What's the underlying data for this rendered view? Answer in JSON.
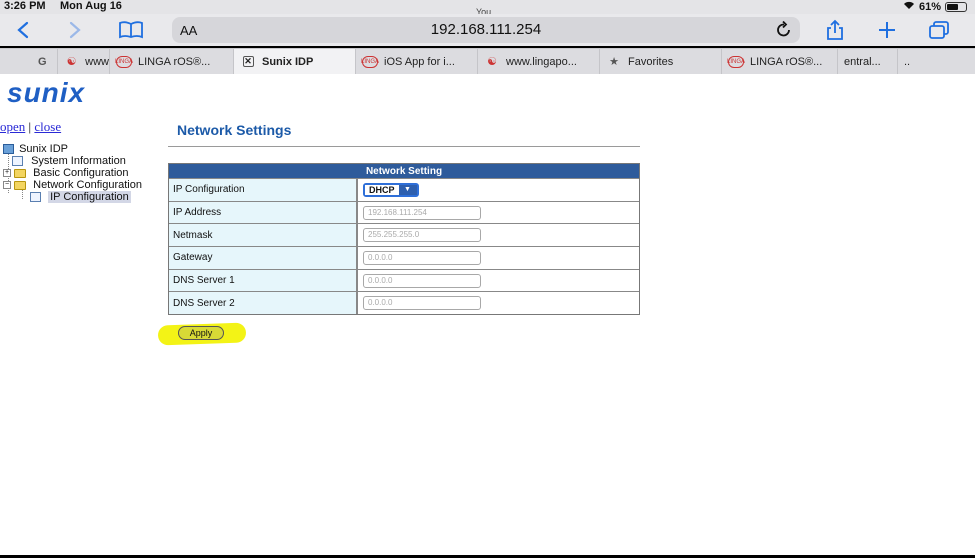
{
  "status_bar": {
    "time": "3:26 PM",
    "date": "Mon Aug 16",
    "you": "You",
    "battery": "61%",
    "battery_level": 0.61
  },
  "toolbar": {
    "text_size": "AA",
    "url": "192.168.111.254",
    "icons": [
      "back-icon",
      "forward-icon",
      "bookmarks-icon",
      "reload-icon",
      "share-icon",
      "new-tab-icon",
      "tabs-icon"
    ]
  },
  "tabs": [
    {
      "label": "www",
      "favicon": "google"
    },
    {
      "label": "LINGA rOS®...",
      "favicon": "linga"
    },
    {
      "label": "Sunix IDP",
      "favicon": "close",
      "active": true
    },
    {
      "label": "iOS App for i...",
      "favicon": "linga"
    },
    {
      "label": "www.lingapo...",
      "favicon": "person"
    },
    {
      "label": "Favorites",
      "favicon": "star"
    },
    {
      "label": "LINGA rOS®...",
      "favicon": "linga"
    },
    {
      "label": "entral...",
      "favicon": "none"
    },
    {
      "label": "..",
      "favicon": "none"
    }
  ],
  "page": {
    "logo": "sunix",
    "tree_controls": {
      "open": "open",
      "separator": "|",
      "close": "close"
    },
    "tree": {
      "root": "Sunix IDP",
      "items": [
        {
          "label": "System Information"
        },
        {
          "label": "Basic Configuration"
        },
        {
          "label": "Network Configuration"
        },
        {
          "label": "IP Configuration",
          "selected": true
        }
      ]
    },
    "title": "Network Settings",
    "table": {
      "header": "Network Setting",
      "rows": [
        {
          "label": "IP Configuration",
          "type": "select",
          "value": "DHCP"
        },
        {
          "label": "IP Address",
          "type": "input",
          "value": "192.168.111.254"
        },
        {
          "label": "Netmask",
          "type": "input",
          "value": "255.255.255.0"
        },
        {
          "label": "Gateway",
          "type": "input",
          "value": "0.0.0.0"
        },
        {
          "label": "DNS Server 1",
          "type": "input",
          "value": "0.0.0.0"
        },
        {
          "label": "DNS Server 2",
          "type": "input",
          "value": "0.0.0.0"
        }
      ]
    },
    "apply_label": "Apply",
    "highlight_color": "#f3f316",
    "accent_color": "#1c5aa8"
  }
}
